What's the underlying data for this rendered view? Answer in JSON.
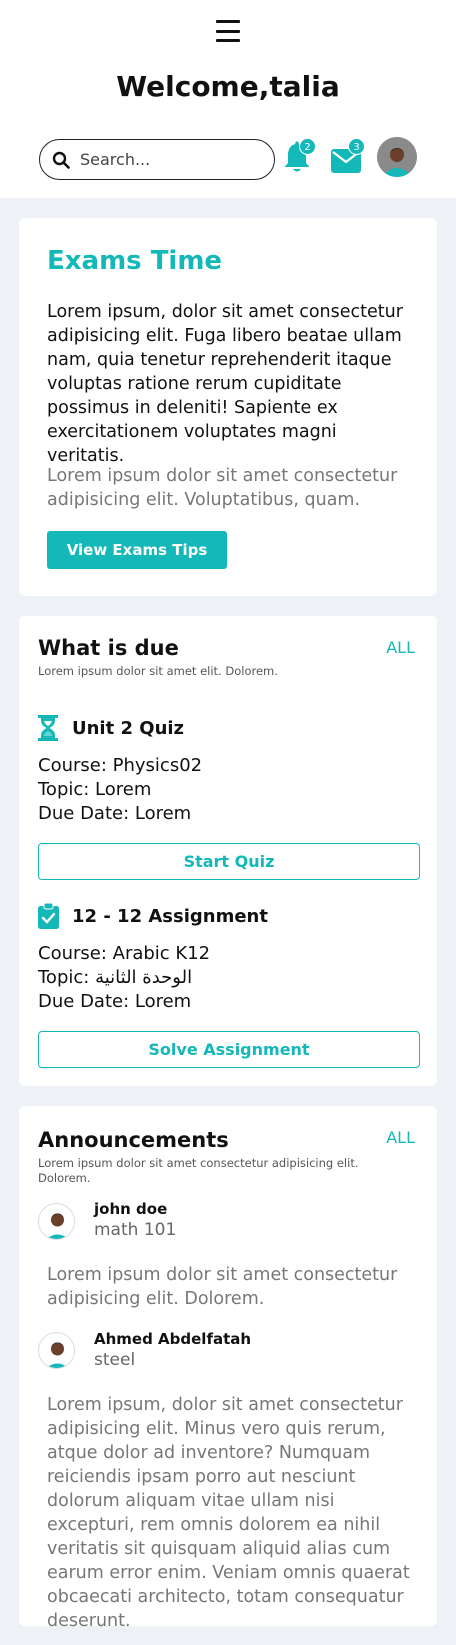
{
  "header": {
    "welcome": "Welcome,talia",
    "search_placeholder": "Search...",
    "notification_count": "2",
    "message_count": "3"
  },
  "exams": {
    "title": "Exams Time",
    "body": "Lorem ipsum, dolor sit amet consectetur adipisicing elit. Fuga libero beatae ullam nam, quia tenetur reprehenderit itaque voluptas ratione rerum cupiditate possimus in deleniti! Sapiente ex exercitationem voluptates magni veritatis.",
    "subtext": "Lorem ipsum dolor sit amet consectetur adipisicing elit. Voluptatibus, quam.",
    "button_label": "View Exams Tips"
  },
  "due": {
    "title": "What is due",
    "subtitle": "Lorem ipsum dolor sit amet elit. Dolorem.",
    "all_label": "ALL",
    "items": [
      {
        "title": "Unit 2 Quiz",
        "course": "Course: Physics02",
        "topic": "Topic: Lorem",
        "due": "Due Date: Lorem",
        "button": "Start Quiz",
        "icon": "hourglass-icon"
      },
      {
        "title": "12 - 12 Assignment",
        "course": "Course: Arabic K12",
        "topic": "Topic: الوحدة الثانية",
        "due": "Due Date: Lorem",
        "button": "Solve Assignment",
        "icon": "clipboard-check-icon"
      }
    ]
  },
  "announcements": {
    "title": "Announcements",
    "subtitle_line1": "Lorem ipsum dolor sit amet consectetur adipisicing elit.",
    "subtitle_line2": "Dolorem.",
    "all_label": "ALL",
    "items": [
      {
        "name": "john doe",
        "course": "math 101",
        "text": "Lorem ipsum dolor sit amet consectetur adipisicing elit. Dolorem."
      },
      {
        "name": "Ahmed Abdelfatah",
        "course": "steel",
        "text": "Lorem ipsum, dolor sit amet consectetur adipisicing elit. Minus vero quis rerum, atque dolor ad inventore? Numquam reiciendis ipsam porro aut nesciunt dolorum aliquam vitae ullam nisi excepturi, rem omnis dolorem ea nihil veritatis sit quisquam aliquid alias cum earum error enim. Veniam omnis quaerat obcaecati architecto, totam consequatur deserunt."
      }
    ]
  },
  "colors": {
    "accent": "#14b8b8",
    "background": "#eef2f7"
  }
}
